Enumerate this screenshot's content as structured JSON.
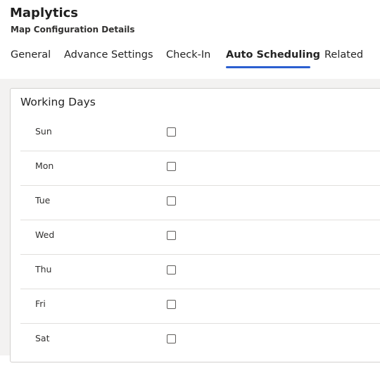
{
  "app": {
    "title": "Maplytics",
    "subtitle": "Map Configuration Details"
  },
  "tabs": [
    {
      "label": "General",
      "active": false
    },
    {
      "label": "Advance Settings",
      "active": false
    },
    {
      "label": "Check-In",
      "active": false
    },
    {
      "label": "Auto Scheduling",
      "active": true
    },
    {
      "label": "Related",
      "active": false
    }
  ],
  "section": {
    "title": "Working Days",
    "days": [
      {
        "label": "Sun",
        "checked": false
      },
      {
        "label": "Mon",
        "checked": false
      },
      {
        "label": "Tue",
        "checked": false
      },
      {
        "label": "Wed",
        "checked": false
      },
      {
        "label": "Thu",
        "checked": false
      },
      {
        "label": "Fri",
        "checked": false
      },
      {
        "label": "Sat",
        "checked": false
      }
    ]
  },
  "colors": {
    "accent": "#2b5fd0",
    "page_background": "#f3f2f1"
  }
}
